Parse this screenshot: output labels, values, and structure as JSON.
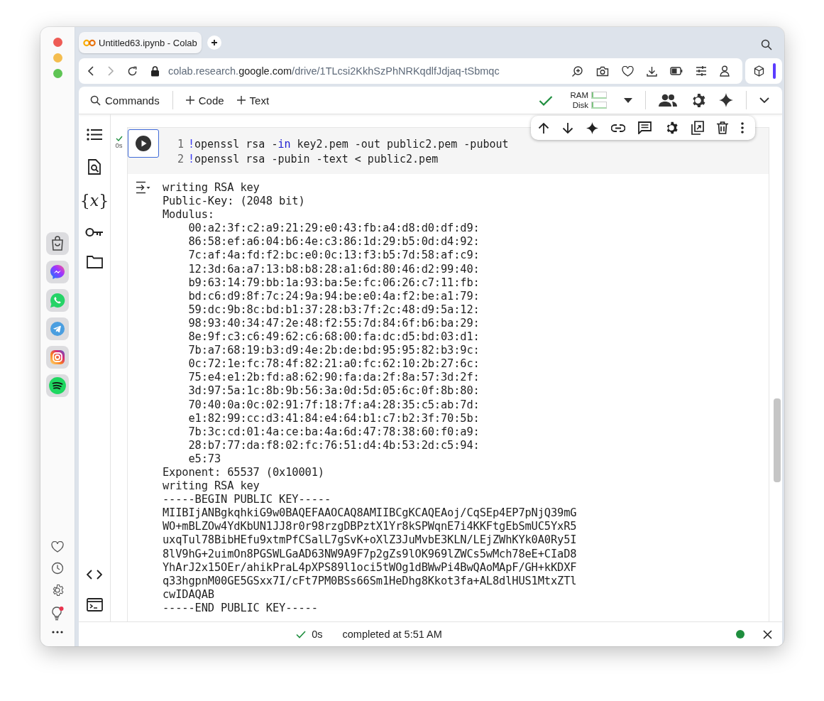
{
  "tab": {
    "title": "Untitled63.ipynb - Colab"
  },
  "address_bar": {
    "host_prefix": "colab.research.",
    "host_domain": "google.com",
    "path": "/drive/1TLcsi2KkhSzPhNRKqdlfJdjaq-tSbmqc"
  },
  "sidebar": {
    "variables_glyph": "{*x*}"
  },
  "toolbar": {
    "commands": "Commands",
    "add_code": "Code",
    "add_text": "Text",
    "ram": {
      "label": "RAM",
      "level": 0.12
    },
    "disk": {
      "label": "Disk",
      "level": 0.12
    }
  },
  "cell": {
    "exec_time": "0s",
    "code_lines": [
      {
        "number": "1",
        "tokens": [
          {
            "text": "!",
            "kind": "magic"
          },
          {
            "text": "openssl rsa -",
            "kind": "plain"
          },
          {
            "text": "in",
            "kind": "keyword"
          },
          {
            "text": " key2.pem -out public2.pem -pubout",
            "kind": "plain"
          }
        ]
      },
      {
        "number": "2",
        "tokens": [
          {
            "text": "!",
            "kind": "magic"
          },
          {
            "text": "openssl rsa -pubin -text < public2.pem",
            "kind": "plain"
          }
        ]
      }
    ],
    "output_lines": [
      "writing RSA key",
      "Public-Key: (2048 bit)",
      "Modulus:",
      "    00:a2:3f:c2:a9:21:29:e0:43:fb:a4:d8:d0:df:d9:",
      "    86:58:ef:a6:04:b6:4e:c3:86:1d:29:b5:0d:d4:92:",
      "    7c:af:4a:fd:f2:bc:e0:0c:13:f3:b5:7d:58:af:c9:",
      "    12:3d:6a:a7:13:b8:b8:28:a1:6d:80:46:d2:99:40:",
      "    b9:63:14:79:bb:1a:93:ba:5e:fc:06:26:c7:11:fb:",
      "    bd:c6:d9:8f:7c:24:9a:94:be:e0:4a:f2:be:a1:79:",
      "    59:dc:9b:8c:bd:b1:37:28:b3:7f:2c:48:d9:5a:12:",
      "    98:93:40:34:47:2e:48:f2:55:7d:84:6f:b6:ba:29:",
      "    8e:9f:c3:c6:49:62:c6:68:00:fa:dc:d5:bd:03:d1:",
      "    7b:a7:68:19:b3:d9:4e:2b:de:bd:95:95:82:b3:9c:",
      "    0c:72:1e:fc:78:4f:82:21:a0:fc:62:10:2b:27:6c:",
      "    75:e4:e1:2b:fd:a8:62:90:fa:da:2f:8a:57:3d:2f:",
      "    3d:97:5a:1c:8b:9b:56:3a:0d:5d:05:6c:0f:8b:80:",
      "    70:40:0a:0c:02:91:7f:18:7f:a4:28:35:c5:ab:7d:",
      "    e1:82:99:cc:d3:41:84:e4:64:b1:c7:b2:3f:70:5b:",
      "    7b:3c:cd:01:4a:ce:ba:4a:6d:47:78:38:60:f0:a9:",
      "    28:b7:77:da:f8:02:fc:76:51:d4:4b:53:2d:c5:94:",
      "    e5:73",
      "Exponent: 65537 (0x10001)",
      "writing RSA key",
      "-----BEGIN PUBLIC KEY-----",
      "MIIBIjANBgkqhkiG9w0BAQEFAAOCAQ8AMIIBCgKCAQEAoj/CqSEp4EP7pNjQ39mG",
      "WO+mBLZOw4YdKbUN1JJ8r0r98rzgDBPztX1Yr8kSPWqnE7i4KKFtgEbSmUC5YxR5",
      "uxqTul78BibHEfu9xtmPfCSalL7gSvK+oXlZ3JuMvbE3KLN/LEjZWhKYk0A0Ry5I",
      "8lV9hG+2uimOn8PGSWLGaAD63NW9A9F7p2gZs9lOK969lZWCs5wMch78eE+CIaD8",
      "YhArJ2x15OEr/ahikPraL4pXPS89l1oci5tWOg1dBWwPi4BwQAoMApF/GH+kKDXF",
      "q33hgpnM00GE5GSxx7I/cFt7PM0BSs66Sm1HeDhg8Kkot3fa+AL8dlHUS1MtxZTl",
      "cwIDAQAB",
      "-----END PUBLIC KEY-----"
    ]
  },
  "status_bar": {
    "duration": "0s",
    "message": "completed at 5:51 AM"
  }
}
